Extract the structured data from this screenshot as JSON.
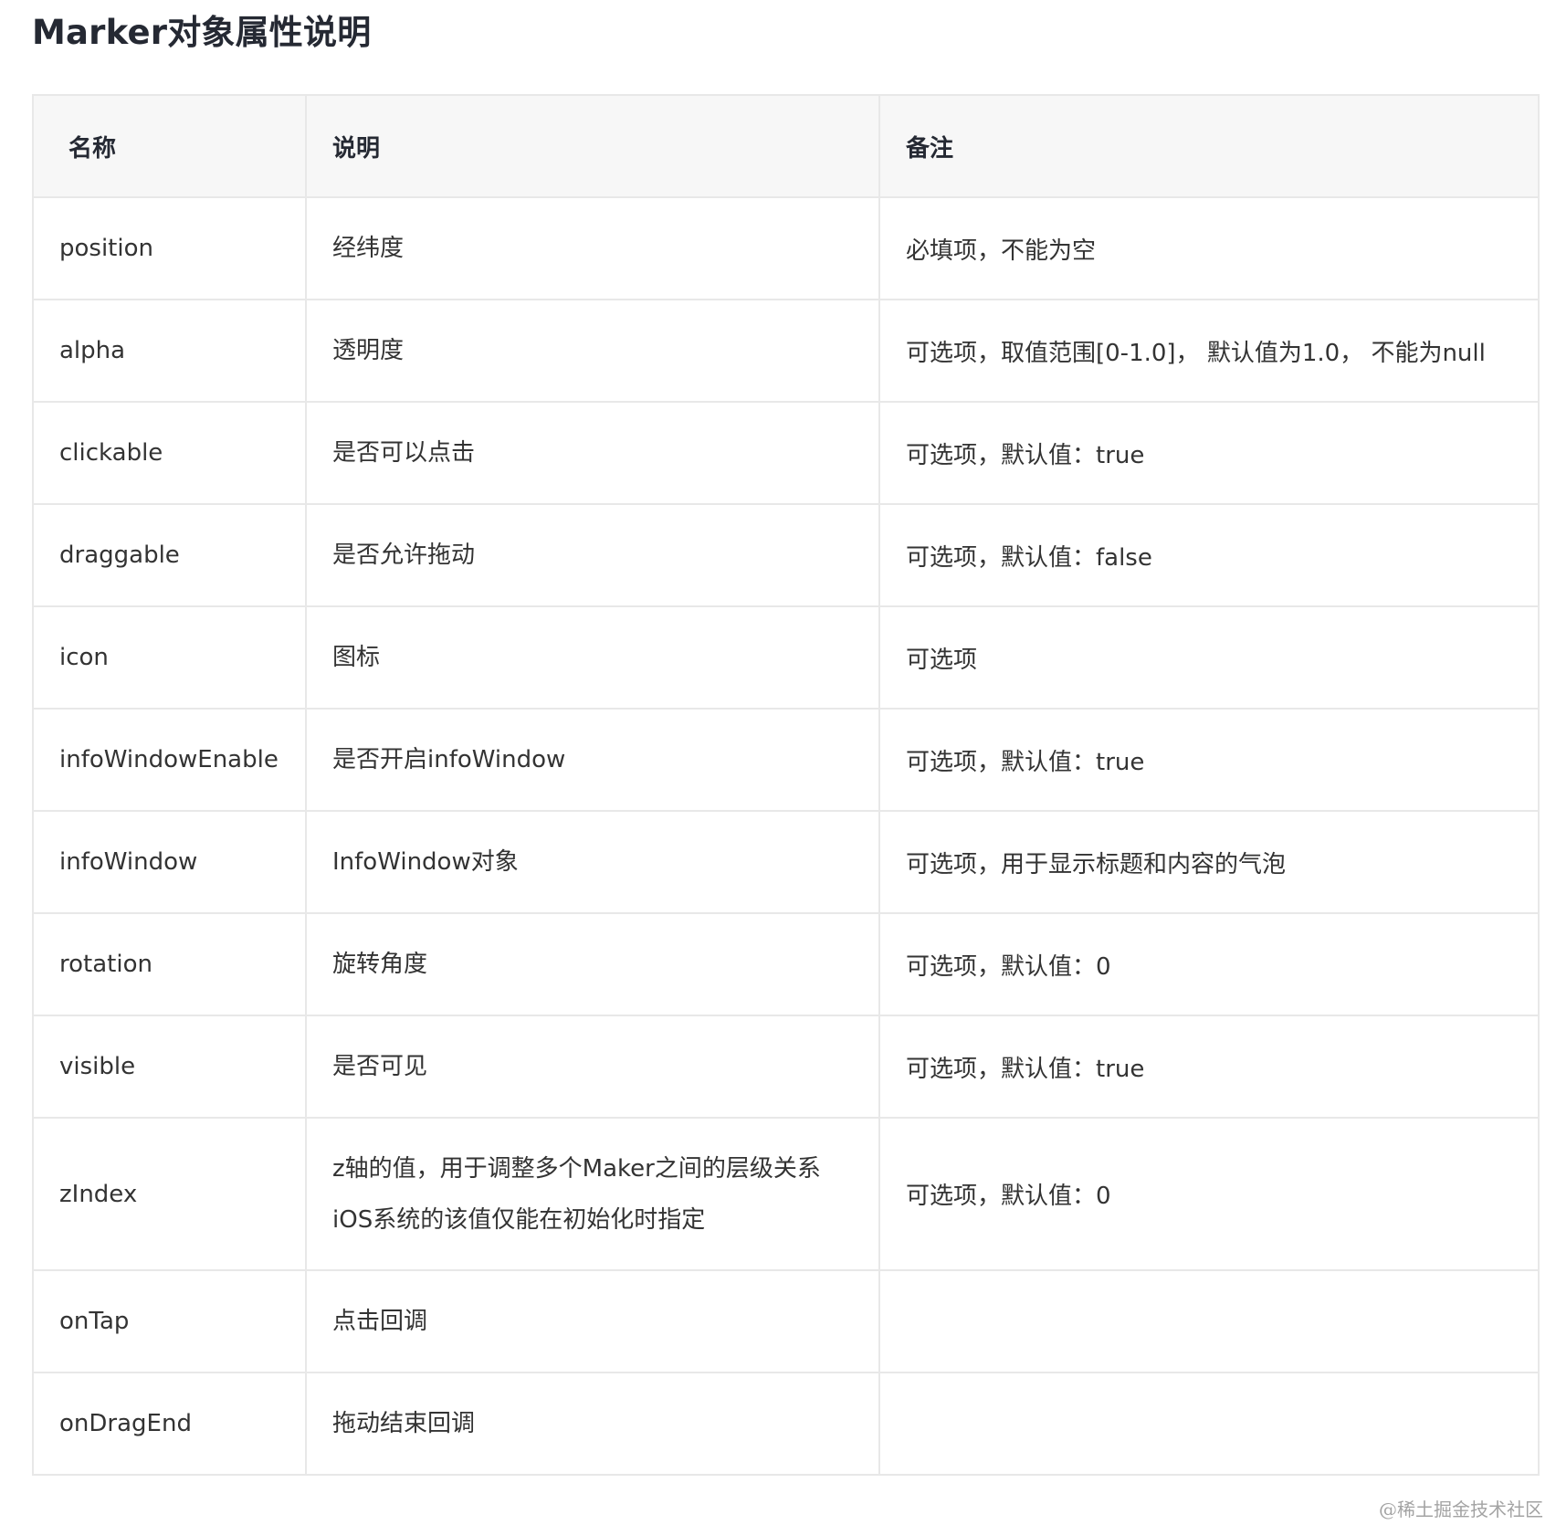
{
  "title": "Marker对象属性说明",
  "table": {
    "headers": [
      "名称",
      "说明",
      "备注"
    ],
    "rows": [
      {
        "name": "position",
        "desc": [
          "经纬度"
        ],
        "note": "必填项，不能为空"
      },
      {
        "name": "alpha",
        "desc": [
          "透明度"
        ],
        "note": "可选项，取值范围[0-1.0]， 默认值为1.0， 不能为null"
      },
      {
        "name": "clickable",
        "desc": [
          "是否可以点击"
        ],
        "note": "可选项，默认值：true"
      },
      {
        "name": "draggable",
        "desc": [
          "是否允许拖动"
        ],
        "note": "可选项，默认值：false"
      },
      {
        "name": "icon",
        "desc": [
          "图标"
        ],
        "note": "可选项"
      },
      {
        "name": "infoWindowEnable",
        "desc": [
          "是否开启infoWindow"
        ],
        "note": "可选项，默认值：true"
      },
      {
        "name": "infoWindow",
        "desc": [
          "InfoWindow对象"
        ],
        "note": "可选项，用于显示标题和内容的气泡"
      },
      {
        "name": "rotation",
        "desc": [
          "旋转角度"
        ],
        "note": "可选项，默认值：0"
      },
      {
        "name": "visible",
        "desc": [
          "是否可见"
        ],
        "note": "可选项，默认值：true"
      },
      {
        "name": "zIndex",
        "desc": [
          "z轴的值，用于调整多个Maker之间的层级关系",
          "iOS系统的该值仅能在初始化时指定"
        ],
        "note": "可选项，默认值：0"
      },
      {
        "name": "onTap",
        "desc": [
          "点击回调"
        ],
        "note": ""
      },
      {
        "name": "onDragEnd",
        "desc": [
          "拖动结束回调"
        ],
        "note": ""
      }
    ]
  },
  "watermark": "@稀土掘金技术社区"
}
